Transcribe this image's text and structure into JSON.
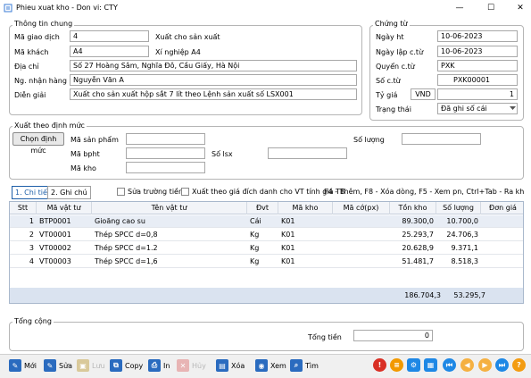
{
  "window": {
    "title": "Phieu xuat kho - Don vi: CTY",
    "min": "—",
    "max": "☐",
    "close": "✕"
  },
  "general": {
    "title": "Thông tin chung",
    "ma_giao_dich_label": "Mã giao dịch",
    "ma_giao_dich": "4",
    "ma_giao_dich_desc": "Xuất cho sản xuất",
    "ma_khach_label": "Mã khách",
    "ma_khach": "A4",
    "ma_khach_desc": "Xí nghiệp A4",
    "dia_chi_label": "Địa chỉ",
    "dia_chi": "Số 27 Hoàng Sâm, Nghĩa Đô, Cầu Giấy, Hà Nội",
    "ng_nhan_hang_label": "Ng. nhận hàng",
    "ng_nhan_hang": "Nguyễn Văn A",
    "dien_giai_label": "Diễn giải",
    "dien_giai": "Xuất cho sản xuất hộp sắt 7 lít theo Lệnh sản xuất số LSX001"
  },
  "voucher": {
    "title": "Chứng từ",
    "ngay_ht_label": "Ngày ht",
    "ngay_ht": "10-06-2023",
    "ngay_lap_label": "Ngày lập c.từ",
    "ngay_lap": "10-06-2023",
    "quyen_label": "Quyển c.từ",
    "quyen": "PXK",
    "so_ct_label": "Số c.từ",
    "so_ct": "PXK00001",
    "ty_gia_label": "Tỷ giá",
    "currency": "VND",
    "ty_gia": "1",
    "trang_thai_label": "Trạng thái",
    "trang_thai": "Đã ghi sổ cái"
  },
  "norm": {
    "title": "Xuất theo định mức",
    "btn": "Chọn định mức",
    "ma_san_pham_label": "Mã sản phẩm",
    "ma_bpht_label": "Mã bpht",
    "ma_kho_label": "Mã kho",
    "so_luong_label": "Số lượng",
    "so_lsx_label": "Số lsx"
  },
  "tabs": {
    "detail": "1. Chi tiết",
    "note": "2. Ghi chú"
  },
  "options": {
    "sua_truong_tien": "Sửa trường tiền",
    "xuat_gia_dich_danh": "Xuất theo giá đích danh cho VT tính giá TB",
    "hint": "F4 - Thêm, F8 - Xóa dòng, F5 - Xem pn, Ctrl+Tab - Ra khỏi chi tiết"
  },
  "grid": {
    "headers": [
      "Stt",
      "Mã vật tư",
      "Tên vật tư",
      "Đvt",
      "Mã kho",
      "Mã cớ(px)",
      "Tồn kho",
      "Số lượng",
      "Đơn giá"
    ],
    "rows": [
      [
        "1",
        "BTP0001",
        "Gioăng cao su",
        "Cái",
        "K01",
        "",
        "89.300,0",
        "10.700,0"
      ],
      [
        "2",
        "VT00001",
        "Thép SPCC d=0,8",
        "Kg",
        "K01",
        "",
        "25.293,7",
        "24.706,3"
      ],
      [
        "3",
        "VT00002",
        "Thép SPCC d=1.2",
        "Kg",
        "K01",
        "",
        "20.628,9",
        "9.371,1"
      ],
      [
        "4",
        "VT00003",
        "Thép SPCC d=1,6",
        "Kg",
        "K01",
        "",
        "51.481,7",
        "8.518,3"
      ]
    ],
    "total_ton_kho": "186.704,3",
    "total_so_luong": "53.295,7"
  },
  "totals": {
    "title": "Tổng cộng",
    "tong_tien_label": "Tổng tiền",
    "tong_tien": "0"
  },
  "toolbar": {
    "moi": "Mới",
    "sua": "Sửa",
    "luu": "Lưu",
    "copy": "Copy",
    "in": "In",
    "huy": "Hủy",
    "xoa": "Xóa",
    "xem": "Xem",
    "tim": "Tìm"
  },
  "colors": {
    "accent": "#1e5fa8",
    "grid_footer": "#dae3f0",
    "grid_selected": "#e8edf5"
  }
}
